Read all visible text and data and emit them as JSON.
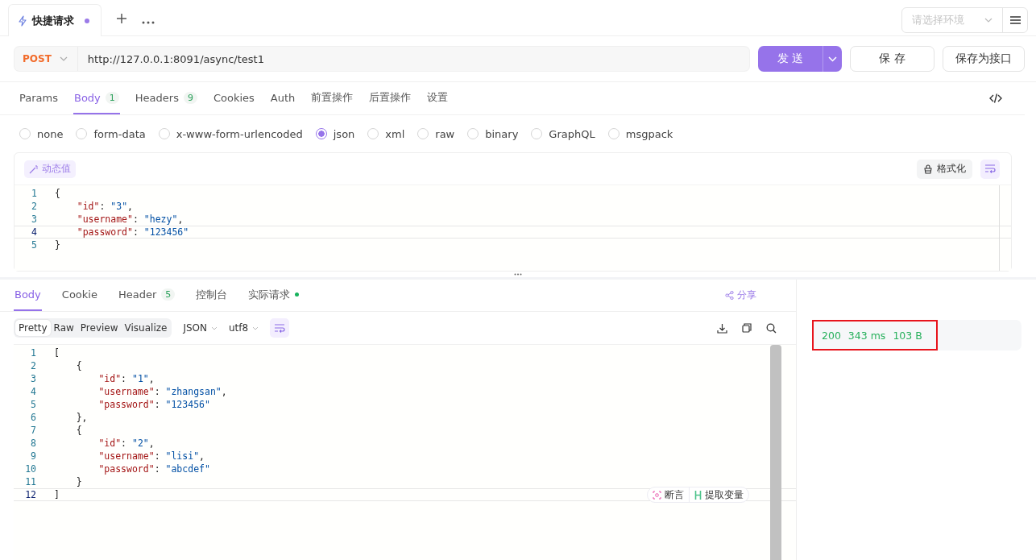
{
  "request_tabs": [
    {
      "label": "快捷请求",
      "selected": true,
      "modified": true
    }
  ],
  "environment": {
    "placeholder": "请选择环境"
  },
  "request": {
    "method": "POST",
    "url": "http://127.0.0.1:8091/async/test1"
  },
  "buttons": {
    "send": "发 送",
    "save": "保 存",
    "save_as": "保存为接口"
  },
  "param_tabs": [
    {
      "label": "Params",
      "selected": false
    },
    {
      "label": "Body",
      "badge": "1",
      "selected": true
    },
    {
      "label": "Headers",
      "badge": "9",
      "selected": false
    },
    {
      "label": "Cookies",
      "selected": false
    },
    {
      "label": "Auth",
      "selected": false
    },
    {
      "label": "前置操作",
      "selected": false
    },
    {
      "label": "后置操作",
      "selected": false
    },
    {
      "label": "设置",
      "selected": false
    }
  ],
  "body_types": [
    {
      "label": "none",
      "selected": false
    },
    {
      "label": "form-data",
      "selected": false
    },
    {
      "label": "x-www-form-urlencoded",
      "selected": false
    },
    {
      "label": "json",
      "selected": true
    },
    {
      "label": "xml",
      "selected": false
    },
    {
      "label": "raw",
      "selected": false
    },
    {
      "label": "binary",
      "selected": false
    },
    {
      "label": "GraphQL",
      "selected": false
    },
    {
      "label": "msgpack",
      "selected": false
    }
  ],
  "request_editor": {
    "dynamic_value": "动态值",
    "format": "格式化",
    "lines": [
      {
        "n": "1",
        "text": "{",
        "current": false
      },
      {
        "n": "2",
        "text": "    \"id\": \"3\",",
        "current": false
      },
      {
        "n": "3",
        "text": "    \"username\": \"hezy\",",
        "current": false
      },
      {
        "n": "4",
        "text": "    \"password\": \"123456\"",
        "current": true
      },
      {
        "n": "5",
        "text": "}",
        "current": false
      }
    ]
  },
  "response_tabs": [
    {
      "label": "Body",
      "selected": true
    },
    {
      "label": "Cookie",
      "selected": false
    },
    {
      "label": "Header",
      "badge": "5",
      "selected": false
    },
    {
      "label": "控制台",
      "selected": false
    },
    {
      "label": "实际请求",
      "dot": true,
      "selected": false
    }
  ],
  "share": "分享",
  "view_modes": [
    {
      "label": "Pretty",
      "selected": true
    },
    {
      "label": "Raw",
      "selected": false
    },
    {
      "label": "Preview",
      "selected": false
    },
    {
      "label": "Visualize",
      "selected": false
    }
  ],
  "format_select": "JSON",
  "encoding_select": "utf8",
  "response_editor": {
    "lines": [
      {
        "n": "1",
        "text": "[",
        "current": false
      },
      {
        "n": "2",
        "text": "    {",
        "current": false
      },
      {
        "n": "3",
        "text": "        \"id\": \"1\",",
        "current": false
      },
      {
        "n": "4",
        "text": "        \"username\": \"zhangsan\",",
        "current": false
      },
      {
        "n": "5",
        "text": "        \"password\": \"123456\"",
        "current": false
      },
      {
        "n": "6",
        "text": "    },",
        "current": false
      },
      {
        "n": "7",
        "text": "    {",
        "current": false
      },
      {
        "n": "8",
        "text": "        \"id\": \"2\",",
        "current": false
      },
      {
        "n": "9",
        "text": "        \"username\": \"lisi\",",
        "current": false
      },
      {
        "n": "10",
        "text": "        \"password\": \"abcdef\"",
        "current": false
      },
      {
        "n": "11",
        "text": "    }",
        "current": false
      },
      {
        "n": "12",
        "text": "]",
        "current": true
      }
    ],
    "assert": "断言",
    "extract": "提取变量"
  },
  "status": {
    "code": "200",
    "time": "343 ms",
    "size": "103 B"
  }
}
